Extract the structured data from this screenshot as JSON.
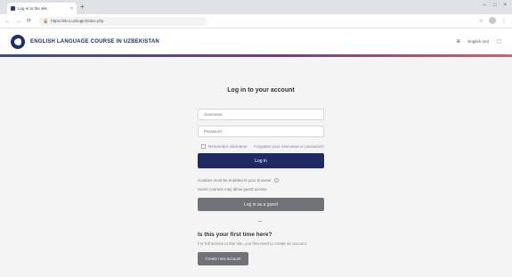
{
  "browser": {
    "tab_title": "Log in to the site",
    "tab_close": "×",
    "new_tab": "+",
    "window_controls": [
      "–",
      "□",
      "×"
    ],
    "nav": {
      "back": "←",
      "forward": "→",
      "reload": "⟳"
    },
    "address": "https://elcu.uz/login/index.php",
    "toolbar_icons": [
      "☆",
      "⋮"
    ]
  },
  "header": {
    "site_name": "ENGLISH LANGUAGE COURSE IN UZBEKISTAN",
    "language": "English (en)",
    "language_icon": "globe-icon",
    "menu_icon": "square-icon"
  },
  "colors": {
    "primary": "#1f2a63",
    "secondary_button": "#6f7377",
    "page_bg": "#f4f4f4",
    "accent_gradient": [
      "#3c4a8c",
      "#7a3a86",
      "#e05a6a"
    ]
  },
  "login": {
    "title": "Log in to your account",
    "username_placeholder": "Username",
    "password_placeholder": "Password",
    "remember_label": "Remember username",
    "forgot_link": "Forgotten your username or password?",
    "login_button": "Log in",
    "cookie_notice": "Cookies must be enabled in your browser",
    "guest_notice": "Some courses may allow guest access",
    "guest_button": "Log in as a guest"
  },
  "signup": {
    "title": "Is this your first time here?",
    "description": "For full access to this site, you first need to create an account.",
    "button": "Create new account"
  }
}
